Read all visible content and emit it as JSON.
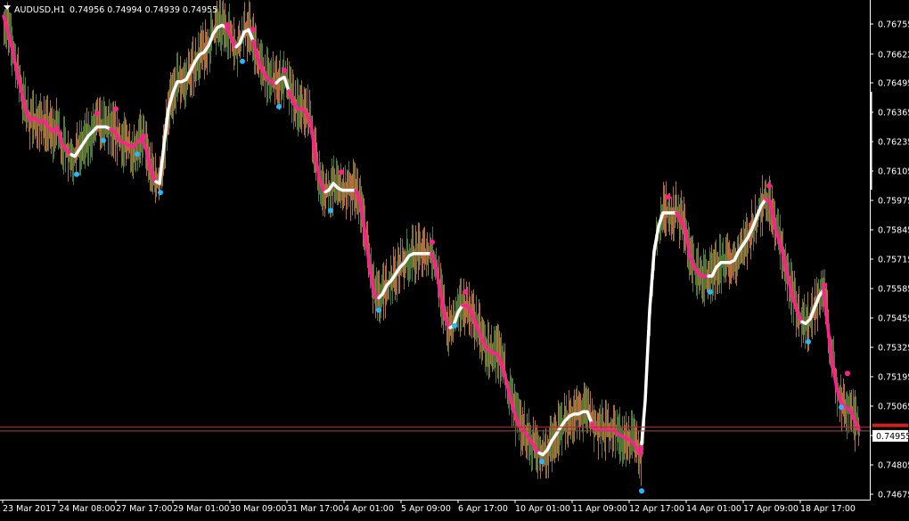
{
  "header": {
    "symbol_label": "AUDUSD,H1",
    "ohlc": "0.74956 0.74994 0.74939 0.74955"
  },
  "colors": {
    "background": "#000000",
    "axis": "#ffffff",
    "bull_bar": "#4a7a33",
    "bear_bar": "#b86a3a",
    "line_down": "#ff1f8e",
    "line_up": "#ffffff",
    "dot_top": "#ff1f8e",
    "dot_bottom": "#27b7ff",
    "bid_line": "#cc2222",
    "ask_line": "#9c4a4a",
    "price_tag_fill": "#ffffff",
    "price_tag_text": "#000000"
  },
  "chart_data": {
    "type": "line",
    "title": "AUDUSD,H1",
    "ylim": [
      0.74675,
      0.768
    ],
    "y_ticks": [
      "0.76755",
      "0.76622",
      "0.76495",
      "0.76365",
      "0.76235",
      "0.76105",
      "0.75975",
      "0.75845",
      "0.75715",
      "0.75585",
      "0.75455",
      "0.75325",
      "0.75195",
      "0.75065",
      "0.74935",
      "0.74805",
      "0.74675"
    ],
    "x_ticks": [
      "23 Mar 2017",
      "24 Mar 08:00",
      "27 Mar 17:00",
      "29 Mar 01:00",
      "30 Mar 09:00",
      "31 Mar 17:00",
      "4 Apr 01:00",
      "5 Apr 09:00",
      "6 Apr 17:00",
      "10 Apr 01:00",
      "11 Apr 09:00",
      "12 Apr 17:00",
      "14 Apr 01:00",
      "17 Apr 09:00",
      "18 Apr 17:00"
    ],
    "current_price": "0.74955",
    "bid_price": 0.74972,
    "ask_price": 0.74955,
    "price_curve": [
      [
        0,
        0.7679
      ],
      [
        5,
        0.7672
      ],
      [
        10,
        0.7664
      ],
      [
        15,
        0.7654
      ],
      [
        20,
        0.7646
      ],
      [
        25,
        0.7637
      ],
      [
        30,
        0.7633
      ],
      [
        35,
        0.7634
      ],
      [
        40,
        0.7632
      ],
      [
        45,
        0.7633
      ],
      [
        50,
        0.763
      ],
      [
        55,
        0.7628
      ],
      [
        60,
        0.763
      ],
      [
        65,
        0.7623
      ],
      [
        70,
        0.762
      ],
      [
        75,
        0.7618
      ],
      [
        80,
        0.7617
      ],
      [
        85,
        0.762
      ],
      [
        90,
        0.7623
      ],
      [
        95,
        0.7626
      ],
      [
        100,
        0.7628
      ],
      [
        105,
        0.763
      ],
      [
        110,
        0.763
      ],
      [
        115,
        0.763
      ],
      [
        120,
        0.7629
      ],
      [
        125,
        0.7628
      ],
      [
        130,
        0.7624
      ],
      [
        135,
        0.7623
      ],
      [
        140,
        0.7622
      ],
      [
        145,
        0.7621
      ],
      [
        150,
        0.7623
      ],
      [
        155,
        0.7625
      ],
      [
        160,
        0.762
      ],
      [
        165,
        0.7611
      ],
      [
        170,
        0.7606
      ],
      [
        175,
        0.7605
      ],
      [
        180,
        0.7622
      ],
      [
        185,
        0.7638
      ],
      [
        190,
        0.7645
      ],
      [
        195,
        0.765
      ],
      [
        200,
        0.765
      ],
      [
        205,
        0.7651
      ],
      [
        210,
        0.7655
      ],
      [
        215,
        0.7659
      ],
      [
        220,
        0.7662
      ],
      [
        225,
        0.7663
      ],
      [
        230,
        0.7666
      ],
      [
        235,
        0.7671
      ],
      [
        240,
        0.7674
      ],
      [
        245,
        0.7675
      ],
      [
        250,
        0.7674
      ],
      [
        255,
        0.767
      ],
      [
        260,
        0.7665
      ],
      [
        265,
        0.7667
      ],
      [
        270,
        0.7672
      ],
      [
        275,
        0.7673
      ],
      [
        280,
        0.7668
      ],
      [
        285,
        0.7661
      ],
      [
        290,
        0.7655
      ],
      [
        295,
        0.7652
      ],
      [
        300,
        0.765
      ],
      [
        305,
        0.7649
      ],
      [
        310,
        0.7651
      ],
      [
        315,
        0.7652
      ],
      [
        320,
        0.7646
      ],
      [
        325,
        0.7641
      ],
      [
        330,
        0.7638
      ],
      [
        335,
        0.7638
      ],
      [
        340,
        0.7636
      ],
      [
        345,
        0.7631
      ],
      [
        350,
        0.7617
      ],
      [
        355,
        0.7606
      ],
      [
        360,
        0.7601
      ],
      [
        365,
        0.7602
      ],
      [
        370,
        0.7605
      ],
      [
        375,
        0.7603
      ],
      [
        380,
        0.7602
      ],
      [
        385,
        0.7602
      ],
      [
        390,
        0.7602
      ],
      [
        395,
        0.7602
      ],
      [
        400,
        0.7597
      ],
      [
        405,
        0.7585
      ],
      [
        410,
        0.757
      ],
      [
        415,
        0.7557
      ],
      [
        420,
        0.7554
      ],
      [
        425,
        0.7556
      ],
      [
        430,
        0.756
      ],
      [
        435,
        0.7562
      ],
      [
        440,
        0.7565
      ],
      [
        445,
        0.7568
      ],
      [
        450,
        0.757
      ],
      [
        455,
        0.7573
      ],
      [
        460,
        0.7574
      ],
      [
        465,
        0.7574
      ],
      [
        470,
        0.7574
      ],
      [
        475,
        0.7574
      ],
      [
        480,
        0.7574
      ],
      [
        485,
        0.7568
      ],
      [
        490,
        0.7557
      ],
      [
        495,
        0.7546
      ],
      [
        500,
        0.7541
      ],
      [
        505,
        0.7542
      ],
      [
        510,
        0.7548
      ],
      [
        515,
        0.7551
      ],
      [
        520,
        0.7551
      ],
      [
        525,
        0.7548
      ],
      [
        530,
        0.7543
      ],
      [
        535,
        0.7538
      ],
      [
        540,
        0.7533
      ],
      [
        545,
        0.7531
      ],
      [
        550,
        0.753
      ],
      [
        555,
        0.7529
      ],
      [
        560,
        0.7524
      ],
      [
        565,
        0.7516
      ],
      [
        570,
        0.7508
      ],
      [
        575,
        0.7501
      ],
      [
        580,
        0.7497
      ],
      [
        585,
        0.7495
      ],
      [
        590,
        0.7492
      ],
      [
        595,
        0.7489
      ],
      [
        600,
        0.7486
      ],
      [
        605,
        0.7485
      ],
      [
        610,
        0.7487
      ],
      [
        615,
        0.7491
      ],
      [
        620,
        0.7494
      ],
      [
        625,
        0.7497
      ],
      [
        630,
        0.75
      ],
      [
        635,
        0.7502
      ],
      [
        640,
        0.7503
      ],
      [
        645,
        0.7503
      ],
      [
        650,
        0.7504
      ],
      [
        655,
        0.7504
      ],
      [
        660,
        0.7499
      ],
      [
        665,
        0.7496
      ],
      [
        670,
        0.7496
      ],
      [
        675,
        0.7496
      ],
      [
        680,
        0.7496
      ],
      [
        685,
        0.7496
      ],
      [
        690,
        0.7494
      ],
      [
        695,
        0.7493
      ],
      [
        700,
        0.7492
      ],
      [
        705,
        0.7491
      ],
      [
        710,
        0.7488
      ],
      [
        715,
        0.7485
      ],
      [
        720,
        0.7509
      ],
      [
        725,
        0.7549
      ],
      [
        730,
        0.7575
      ],
      [
        735,
        0.7586
      ],
      [
        740,
        0.7592
      ],
      [
        745,
        0.7592
      ],
      [
        750,
        0.7592
      ],
      [
        755,
        0.7592
      ],
      [
        760,
        0.7589
      ],
      [
        765,
        0.7585
      ],
      [
        770,
        0.7573
      ],
      [
        775,
        0.7568
      ],
      [
        780,
        0.7565
      ],
      [
        785,
        0.7564
      ],
      [
        790,
        0.7564
      ],
      [
        795,
        0.7564
      ],
      [
        800,
        0.7568
      ],
      [
        805,
        0.757
      ],
      [
        810,
        0.757
      ],
      [
        815,
        0.757
      ],
      [
        820,
        0.7571
      ],
      [
        825,
        0.7575
      ],
      [
        830,
        0.7578
      ],
      [
        835,
        0.7581
      ],
      [
        840,
        0.7585
      ],
      [
        845,
        0.759
      ],
      [
        850,
        0.7595
      ],
      [
        855,
        0.7598
      ],
      [
        860,
        0.7597
      ],
      [
        865,
        0.7587
      ],
      [
        870,
        0.758
      ],
      [
        875,
        0.7573
      ],
      [
        880,
        0.7564
      ],
      [
        885,
        0.7555
      ],
      [
        890,
        0.7549
      ],
      [
        895,
        0.7544
      ],
      [
        900,
        0.7543
      ],
      [
        905,
        0.7545
      ],
      [
        910,
        0.755
      ],
      [
        915,
        0.7555
      ],
      [
        920,
        0.7558
      ],
      [
        925,
        0.7541
      ],
      [
        930,
        0.7526
      ],
      [
        935,
        0.7514
      ],
      [
        940,
        0.7508
      ],
      [
        945,
        0.7506
      ],
      [
        950,
        0.7505
      ],
      [
        955,
        0.75
      ],
      [
        960,
        0.7496
      ]
    ],
    "down_segments": [
      [
        0,
        75
      ],
      [
        120,
        170
      ],
      [
        250,
        260
      ],
      [
        280,
        305
      ],
      [
        320,
        360
      ],
      [
        395,
        420
      ],
      [
        480,
        500
      ],
      [
        515,
        600
      ],
      [
        660,
        715
      ],
      [
        755,
        790
      ],
      [
        855,
        895
      ],
      [
        920,
        960
      ]
    ],
    "up_points": [
      [
        82,
        0.7609
      ],
      [
        112,
        0.7624
      ],
      [
        150,
        0.7618
      ],
      [
        176,
        0.7601
      ],
      [
        268,
        0.7659
      ],
      [
        309,
        0.7639
      ],
      [
        367,
        0.7593
      ],
      [
        421,
        0.7549
      ],
      [
        506,
        0.7542
      ],
      [
        604,
        0.7482
      ],
      [
        716,
        0.7469
      ],
      [
        793,
        0.7557
      ],
      [
        903,
        0.7535
      ],
      [
        940,
        0.7506
      ]
    ],
    "down_points": [
      [
        105,
        0.7636
      ],
      [
        126,
        0.7638
      ],
      [
        157,
        0.7626
      ],
      [
        251,
        0.7675
      ],
      [
        280,
        0.7673
      ],
      [
        315,
        0.7655
      ],
      [
        379,
        0.761
      ],
      [
        481,
        0.7579
      ],
      [
        518,
        0.7557
      ],
      [
        746,
        0.7599
      ],
      [
        859,
        0.7604
      ],
      [
        921,
        0.756
      ],
      [
        947,
        0.7521
      ]
    ]
  }
}
